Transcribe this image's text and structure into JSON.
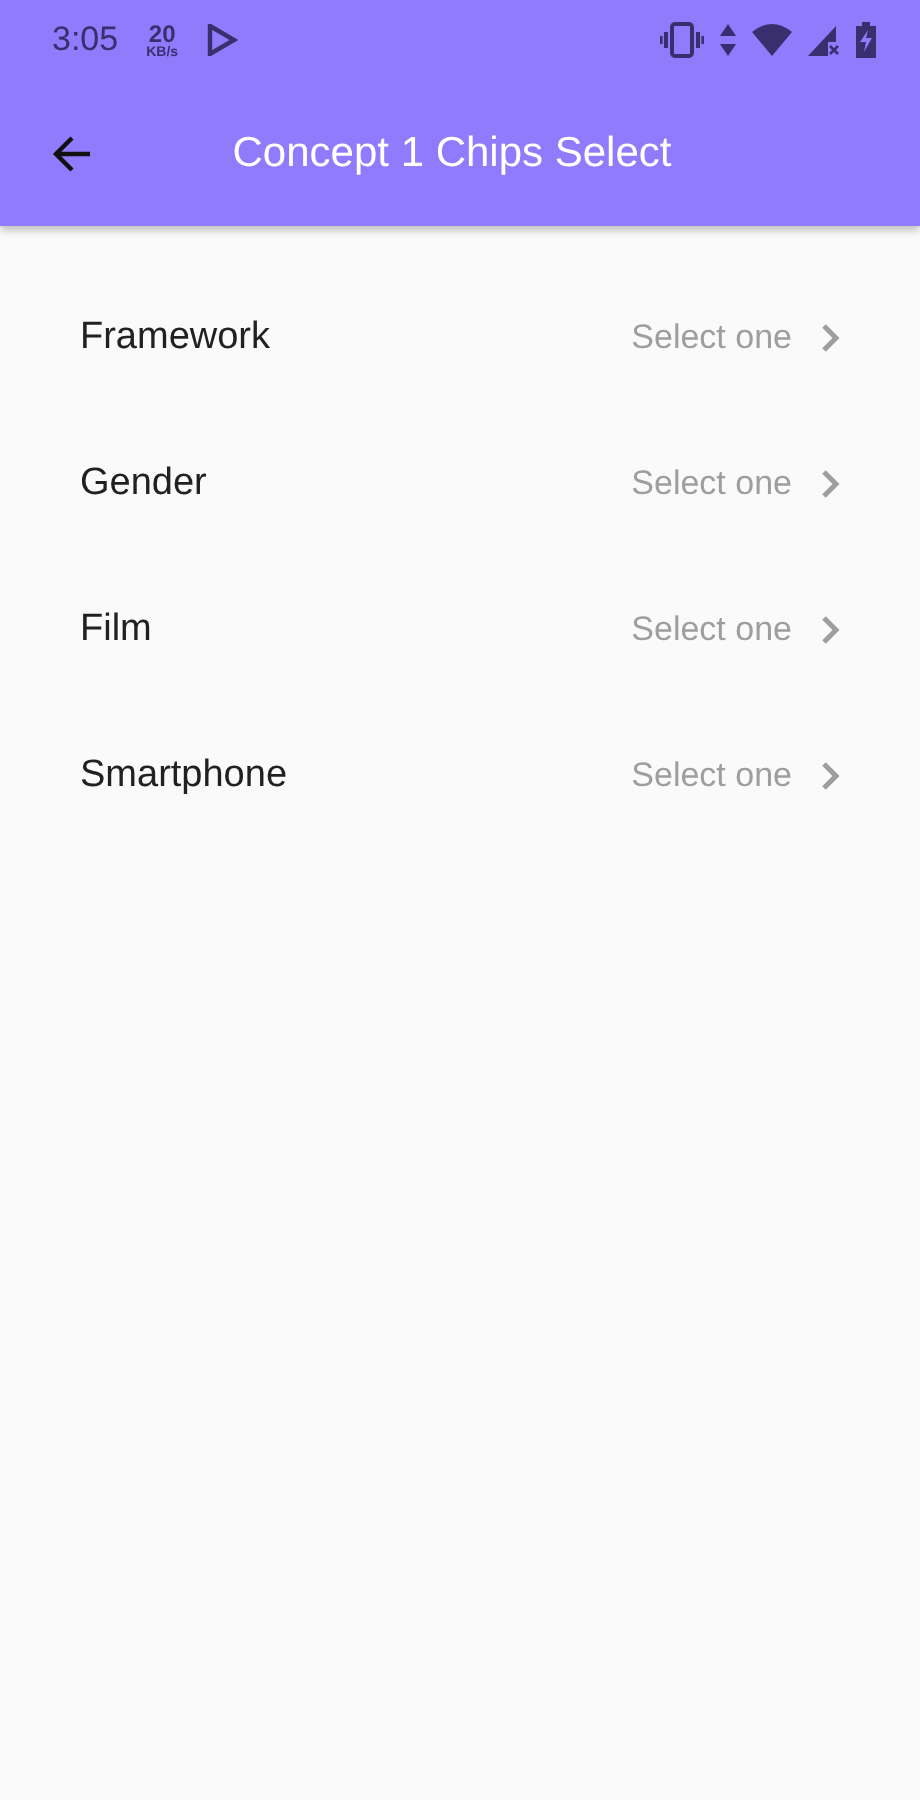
{
  "status_bar": {
    "time": "3:05",
    "speed_value": "20",
    "speed_unit": "KB/s"
  },
  "app_bar": {
    "title": "Concept 1 Chips Select"
  },
  "fields": [
    {
      "label": "Framework",
      "placeholder": "Select one"
    },
    {
      "label": "Gender",
      "placeholder": "Select one"
    },
    {
      "label": "Film",
      "placeholder": "Select one"
    },
    {
      "label": "Smartphone",
      "placeholder": "Select one"
    }
  ]
}
